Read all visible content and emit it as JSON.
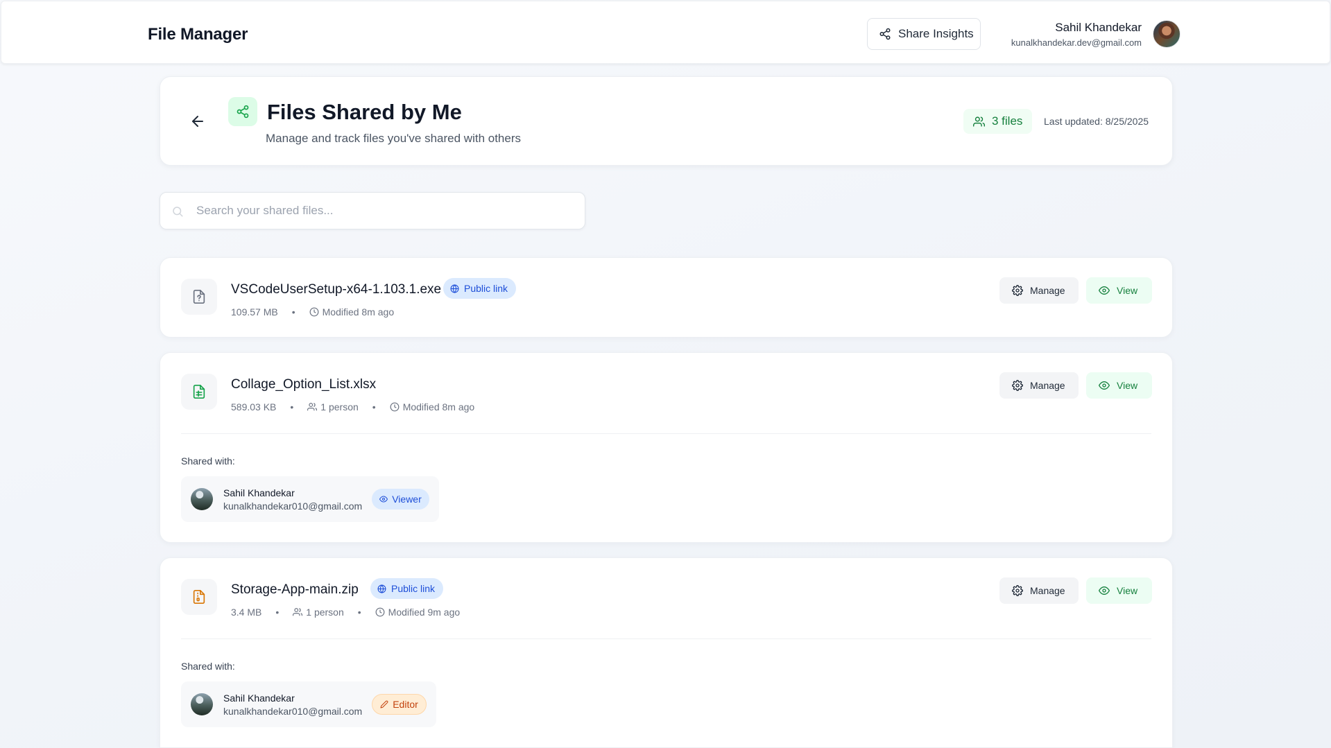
{
  "header": {
    "app_title": "File Manager",
    "share_insights_label": "Share Insights",
    "user_name": "Sahil Khandekar",
    "user_email": "kunalkhandekar.dev@gmail.com"
  },
  "page": {
    "title": "Files Shared by Me",
    "subtitle": "Manage and track files you've shared with others",
    "files_count": "3 files",
    "last_updated": "Last updated: 8/25/2025"
  },
  "search": {
    "placeholder": "Search your shared files...",
    "value": ""
  },
  "labels": {
    "manage": "Manage",
    "view": "View",
    "public_link": "Public link",
    "shared_with": "Shared with:"
  },
  "files": [
    {
      "name": "VSCodeUserSetup-x64-1.103.1.exe",
      "icon": "unknown-file-icon",
      "size": "109.57 MB",
      "people": "",
      "modified": "Modified 8m ago",
      "public": true
    },
    {
      "name": "Collage_Option_List.xlsx",
      "icon": "spreadsheet-file-icon",
      "size": "589.03 KB",
      "people": "1 person",
      "modified": "Modified 8m ago",
      "public": false,
      "shared_with": [
        {
          "name": "Sahil Khandekar",
          "email": "kunalkhandekar010@gmail.com",
          "role": "Viewer"
        }
      ]
    },
    {
      "name": "Storage-App-main.zip",
      "icon": "archive-file-icon",
      "size": "3.4 MB",
      "people": "1 person",
      "modified": "Modified 9m ago",
      "public": true,
      "shared_with": [
        {
          "name": "Sahil Khandekar",
          "email": "kunalkhandekar010@gmail.com",
          "role": "Editor"
        }
      ]
    }
  ],
  "colors": {
    "accent_green": "#15803d",
    "badge_blue": "#1d4ed8",
    "editor_orange": "#c2410c"
  }
}
